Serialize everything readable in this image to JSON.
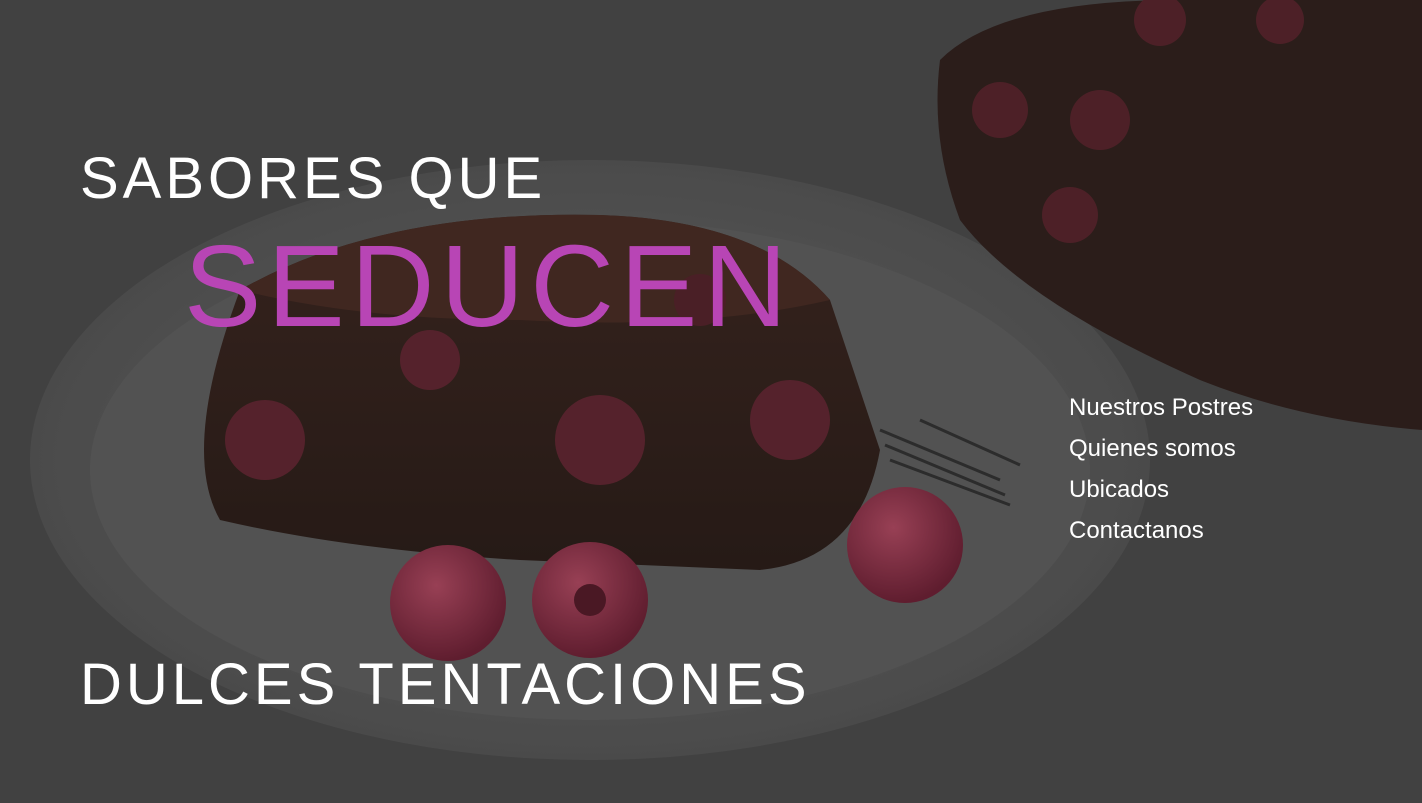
{
  "hero": {
    "headline_top": "SABORES QUE",
    "headline_accent": "SEDUCEN",
    "brand_name": "DULCES TENTACIONES"
  },
  "nav": {
    "items": [
      {
        "label": "Nuestros Postres"
      },
      {
        "label": "Quienes somos"
      },
      {
        "label": "Ubicados"
      },
      {
        "label": "Contactanos"
      }
    ]
  },
  "colors": {
    "accent": "#b845b5",
    "text": "#ffffff",
    "overlay": "#3c3c3c"
  }
}
